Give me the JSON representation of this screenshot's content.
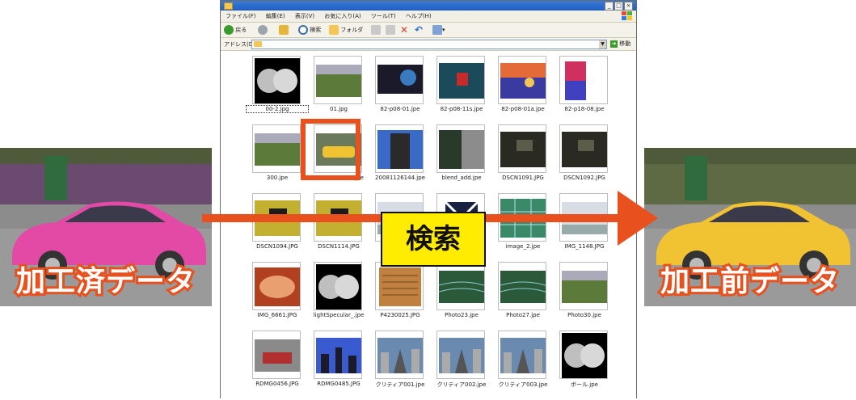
{
  "window": {
    "menu": [
      "ファイル(F)",
      "編集(E)",
      "表示(V)",
      "お気に入り(A)",
      "ツール(T)",
      "ヘルプ(H)"
    ],
    "toolbar": {
      "back_label": "戻る",
      "search_label": "検索",
      "folders_label": "フォルダ"
    },
    "address": {
      "label": "アドレス(D)",
      "value": "",
      "go_label": "移動"
    },
    "buttons": {
      "minimize": "_",
      "maximize": "□",
      "close": "×"
    },
    "files": [
      {
        "name": "00-2.jpg",
        "thumb": "sphere",
        "selected": true
      },
      {
        "name": "01.jpg",
        "thumb": "landscape"
      },
      {
        "name": "82-p08-01.jpe",
        "thumb": "dark-scene"
      },
      {
        "name": "82-p08-11s.jpe",
        "thumb": "red-object"
      },
      {
        "name": "82-p08-01a.jpe",
        "thumb": "sunset"
      },
      {
        "name": "82-p18-08.jpe",
        "thumb": "color-chart"
      },
      {
        "name": "300.jpe",
        "thumb": "landscape"
      },
      {
        "name": "20061121141.jpe",
        "thumb": "taxi"
      },
      {
        "name": "20081126144.jpe",
        "thumb": "building"
      },
      {
        "name": "blend_add.jpe",
        "thumb": "blend"
      },
      {
        "name": "DSCN1091.JPG",
        "thumb": "dark-room"
      },
      {
        "name": "DSCN1092.JPG",
        "thumb": "dark-room"
      },
      {
        "name": "DSCN1094.JPG",
        "thumb": "room-tv"
      },
      {
        "name": "DSCN1114.JPG",
        "thumb": "room-tv"
      },
      {
        "name": "",
        "thumb": "sky"
      },
      {
        "name": "",
        "thumb": "cube"
      },
      {
        "name": "image_2.jpe",
        "thumb": "glass"
      },
      {
        "name": "IMG_1148.JPG",
        "thumb": "sky"
      },
      {
        "name": "IMG_6661.JPG",
        "thumb": "food"
      },
      {
        "name": "lightSpecular_.jpe",
        "thumb": "sphere"
      },
      {
        "name": "P4230025.JPG",
        "thumb": "paper"
      },
      {
        "name": "Photo23.jpe",
        "thumb": "terraces"
      },
      {
        "name": "Photo27.jpe",
        "thumb": "terraces"
      },
      {
        "name": "Photo30.jpe",
        "thumb": "landscape"
      },
      {
        "name": "RDMG0456.JPG",
        "thumb": "station"
      },
      {
        "name": "RDMG0485.JPG",
        "thumb": "city-blue"
      },
      {
        "name": "クリティア001.jpe",
        "thumb": "street"
      },
      {
        "name": "クリティア002.jpe",
        "thumb": "street"
      },
      {
        "name": "クリティア003.jpe",
        "thumb": "street"
      },
      {
        "name": "ボール.jpe",
        "thumb": "sphere"
      }
    ]
  },
  "search_label": "検索",
  "left_photo": {
    "label": "加工済データ",
    "car_color": "#e24aa6"
  },
  "right_photo": {
    "label": "加工前データ",
    "car_color": "#f1c232"
  },
  "colors": {
    "accent_orange": "#e8501e",
    "search_yellow": "#ffec00"
  }
}
